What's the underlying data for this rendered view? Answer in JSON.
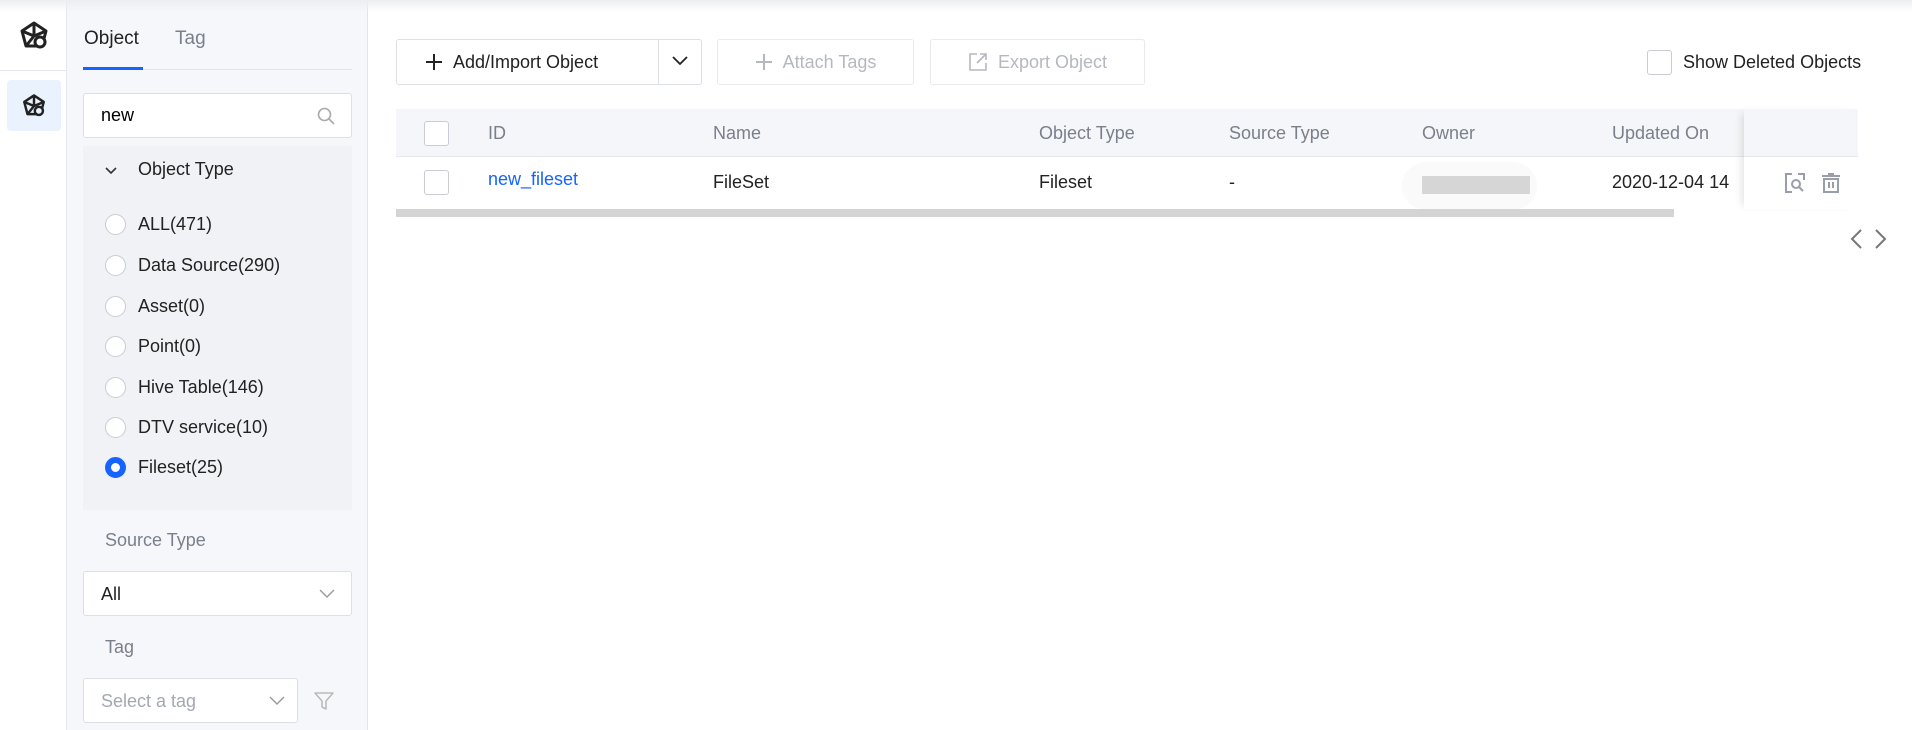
{
  "sidebar": {
    "tabs": [
      "Object",
      "Tag"
    ],
    "search": {
      "value": "new",
      "placeholder": ""
    },
    "object_type": {
      "title": "Object Type",
      "options": [
        "ALL(471)",
        "Data Source(290)",
        "Asset(0)",
        "Point(0)",
        "Hive Table(146)",
        "DTV service(10)",
        "Fileset(25)"
      ],
      "selected": 6
    },
    "source_type": {
      "label": "Source Type",
      "value": "All"
    },
    "tag": {
      "label": "Tag",
      "placeholder": "Select a tag"
    }
  },
  "toolbar": {
    "add": "Add/Import Object",
    "attach": "Attach Tags",
    "export": "Export Object",
    "show_deleted": "Show Deleted Objects"
  },
  "table": {
    "columns": [
      "ID",
      "Name",
      "Object Type",
      "Source Type",
      "Owner",
      "Updated On"
    ],
    "rows": [
      {
        "id": "new_fileset",
        "name": "FileSet",
        "object_type": "Fileset",
        "source_type": "-",
        "owner": "",
        "updated_on": "2020-12-04 14"
      }
    ]
  },
  "colors": {
    "accent": "#1664ff"
  }
}
